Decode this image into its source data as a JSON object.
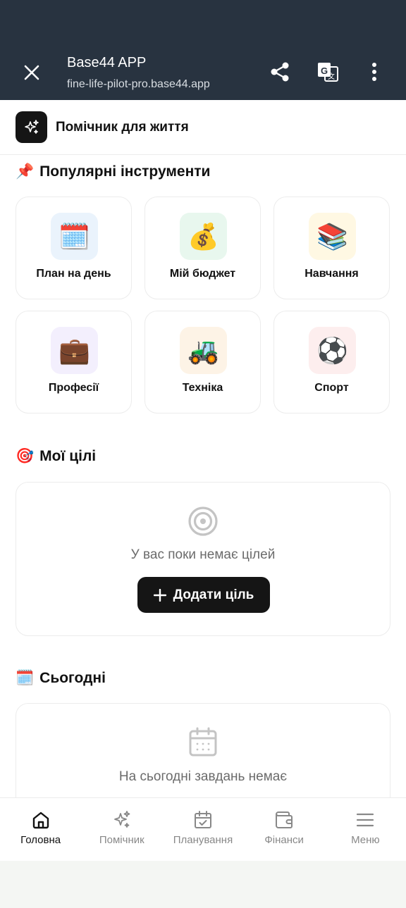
{
  "browser": {
    "title": "Base44 APP",
    "url": "fine-life-pilot-pro.base44.app",
    "icons": [
      "close-icon",
      "share-icon",
      "translate-icon",
      "more-vert-icon"
    ]
  },
  "app": {
    "name": "Помічник для життя",
    "logo_icon": "sparkles-icon"
  },
  "tools": {
    "emoji": "📌",
    "title": "Популярні інструменти",
    "items": [
      {
        "label": "План на день",
        "emoji": "🗓️",
        "bg": "#eaf3fc"
      },
      {
        "label": "Мій бюджет",
        "emoji": "💰",
        "bg": "#e8f7ee"
      },
      {
        "label": "Навчання",
        "emoji": "📚",
        "bg": "#fff8e3"
      },
      {
        "label": "Професії",
        "emoji": "💼",
        "bg": "#f3effd"
      },
      {
        "label": "Техніка",
        "emoji": "🚜",
        "bg": "#fdf3e6"
      },
      {
        "label": "Спорт",
        "emoji": "⚽",
        "bg": "#fdeeee"
      }
    ]
  },
  "goals": {
    "emoji": "🎯",
    "title": "Мої цілі",
    "empty_text": "У вас поки немає цілей",
    "add_label": "Додати ціль"
  },
  "today": {
    "emoji": "🗓️",
    "title": "Сьогодні",
    "empty_text": "На сьогодні завдань немає"
  },
  "nav": {
    "items": [
      {
        "label": "Головна",
        "icon": "home-icon",
        "active": true
      },
      {
        "label": "Помічник",
        "icon": "sparkles-icon",
        "active": false
      },
      {
        "label": "Планування",
        "icon": "calendar-check-icon",
        "active": false
      },
      {
        "label": "Фінанси",
        "icon": "wallet-icon",
        "active": false
      },
      {
        "label": "Меню",
        "icon": "menu-icon",
        "active": false
      }
    ]
  },
  "colors": {
    "browser_bar": "#283340",
    "accent_dark": "#151515",
    "muted_text": "#6b6b6b",
    "nav_inactive": "#888888"
  }
}
